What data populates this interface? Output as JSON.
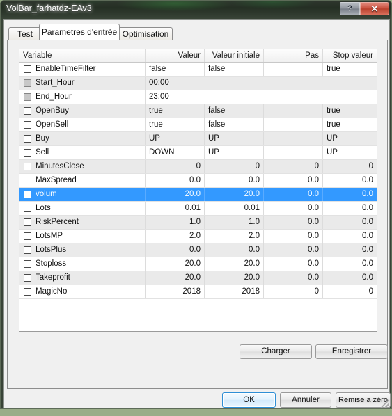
{
  "window": {
    "title": "VolBar_farhatdz-EAv3",
    "help_button": "?",
    "close_button": "✕",
    "accent_blue": "#3399ff",
    "close_red": "#c9503d",
    "frame_green": "#9aad88"
  },
  "tabs": [
    {
      "label": "Test",
      "active": false
    },
    {
      "label": "Parametres d'entrée",
      "active": true
    },
    {
      "label": "Optimisation",
      "active": false
    }
  ],
  "grid": {
    "columns": [
      "Variable",
      "Valeur",
      "Valeur initiale",
      "Pas",
      "Stop valeur"
    ],
    "rows": [
      {
        "name": "EnableTimeFilter",
        "checkbox": "enabled",
        "value": "false",
        "initial": "false",
        "step": "",
        "stop": "true",
        "align": "left",
        "span": false,
        "selected": false
      },
      {
        "name": "Start_Hour",
        "checkbox": "disabled",
        "value": "00:00",
        "initial": "",
        "step": "",
        "stop": "",
        "align": "left",
        "span": true,
        "selected": false
      },
      {
        "name": "End_Hour",
        "checkbox": "disabled",
        "value": "23:00",
        "initial": "",
        "step": "",
        "stop": "",
        "align": "left",
        "span": true,
        "selected": false
      },
      {
        "name": "OpenBuy",
        "checkbox": "enabled",
        "value": "true",
        "initial": "false",
        "step": "",
        "stop": "true",
        "align": "left",
        "span": false,
        "selected": false
      },
      {
        "name": "OpenSell",
        "checkbox": "enabled",
        "value": "true",
        "initial": "false",
        "step": "",
        "stop": "true",
        "align": "left",
        "span": false,
        "selected": false
      },
      {
        "name": "Buy",
        "checkbox": "enabled",
        "value": "UP",
        "initial": "UP",
        "step": "",
        "stop": "UP",
        "align": "left",
        "span": false,
        "selected": false
      },
      {
        "name": "Sell",
        "checkbox": "enabled",
        "value": "DOWN",
        "initial": "UP",
        "step": "",
        "stop": "UP",
        "align": "left",
        "span": false,
        "selected": false
      },
      {
        "name": "MinutesClose",
        "checkbox": "enabled",
        "value": "0",
        "initial": "0",
        "step": "0",
        "stop": "0",
        "align": "right",
        "span": false,
        "selected": false
      },
      {
        "name": "MaxSpread",
        "checkbox": "enabled",
        "value": "0.0",
        "initial": "0.0",
        "step": "0.0",
        "stop": "0.0",
        "align": "right",
        "span": false,
        "selected": false
      },
      {
        "name": "volum",
        "checkbox": "enabled",
        "value": "20.0",
        "initial": "20.0",
        "step": "0.0",
        "stop": "0.0",
        "align": "right",
        "span": false,
        "selected": true
      },
      {
        "name": "Lots",
        "checkbox": "enabled",
        "value": "0.01",
        "initial": "0.01",
        "step": "0.0",
        "stop": "0.0",
        "align": "right",
        "span": false,
        "selected": false
      },
      {
        "name": "RiskPercent",
        "checkbox": "enabled",
        "value": "1.0",
        "initial": "1.0",
        "step": "0.0",
        "stop": "0.0",
        "align": "right",
        "span": false,
        "selected": false
      },
      {
        "name": "LotsMP",
        "checkbox": "enabled",
        "value": "2.0",
        "initial": "2.0",
        "step": "0.0",
        "stop": "0.0",
        "align": "right",
        "span": false,
        "selected": false
      },
      {
        "name": "LotsPlus",
        "checkbox": "enabled",
        "value": "0.0",
        "initial": "0.0",
        "step": "0.0",
        "stop": "0.0",
        "align": "right",
        "span": false,
        "selected": false
      },
      {
        "name": "Stoploss",
        "checkbox": "enabled",
        "value": "20.0",
        "initial": "20.0",
        "step": "0.0",
        "stop": "0.0",
        "align": "right",
        "span": false,
        "selected": false
      },
      {
        "name": "Takeprofit",
        "checkbox": "enabled",
        "value": "20.0",
        "initial": "20.0",
        "step": "0.0",
        "stop": "0.0",
        "align": "right",
        "span": false,
        "selected": false
      },
      {
        "name": "MagicNo",
        "checkbox": "enabled",
        "value": "2018",
        "initial": "2018",
        "step": "0",
        "stop": "0",
        "align": "right",
        "span": false,
        "selected": false
      }
    ]
  },
  "panel_buttons": {
    "load": "Charger",
    "save": "Enregistrer"
  },
  "footer_buttons": {
    "ok": "OK",
    "cancel": "Annuler",
    "reset": "Remise a zéro"
  }
}
